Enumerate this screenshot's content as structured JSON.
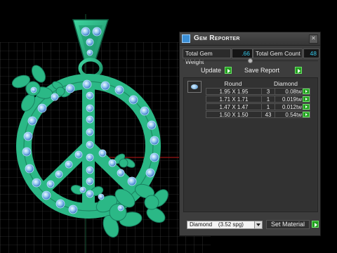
{
  "colors": {
    "jewelry_green": "#2bb886",
    "gem_blue": "#8fc3ef",
    "value_cyan": "#34c6e8",
    "button_green": "#23a020"
  },
  "panel": {
    "title": "Gem Reporter",
    "total_weight_label": "Total Gem Weight",
    "total_weight_value": ".66",
    "total_count_label": "Total Gem Count",
    "total_count_value": "48",
    "update_label": "Update",
    "save_report_label": "Save Report",
    "close_icon": "close-icon",
    "table": {
      "gem_icon": "gem-round-icon",
      "header_shape": "Round",
      "header_material": "Diamond",
      "rows": [
        {
          "size": "1.95 X 1.95",
          "count": "3",
          "weight": "0.08tw"
        },
        {
          "size": "1.71 X 1.71",
          "count": "1",
          "weight": "0.019tw"
        },
        {
          "size": "1.47 X 1.47",
          "count": "1",
          "weight": "0.012tw"
        },
        {
          "size": "1.50 X 1.50",
          "count": "43",
          "weight": "0.54tw"
        }
      ]
    },
    "material_select": "Diamond    (3.52 spg)",
    "set_material_label": "Set Material"
  }
}
